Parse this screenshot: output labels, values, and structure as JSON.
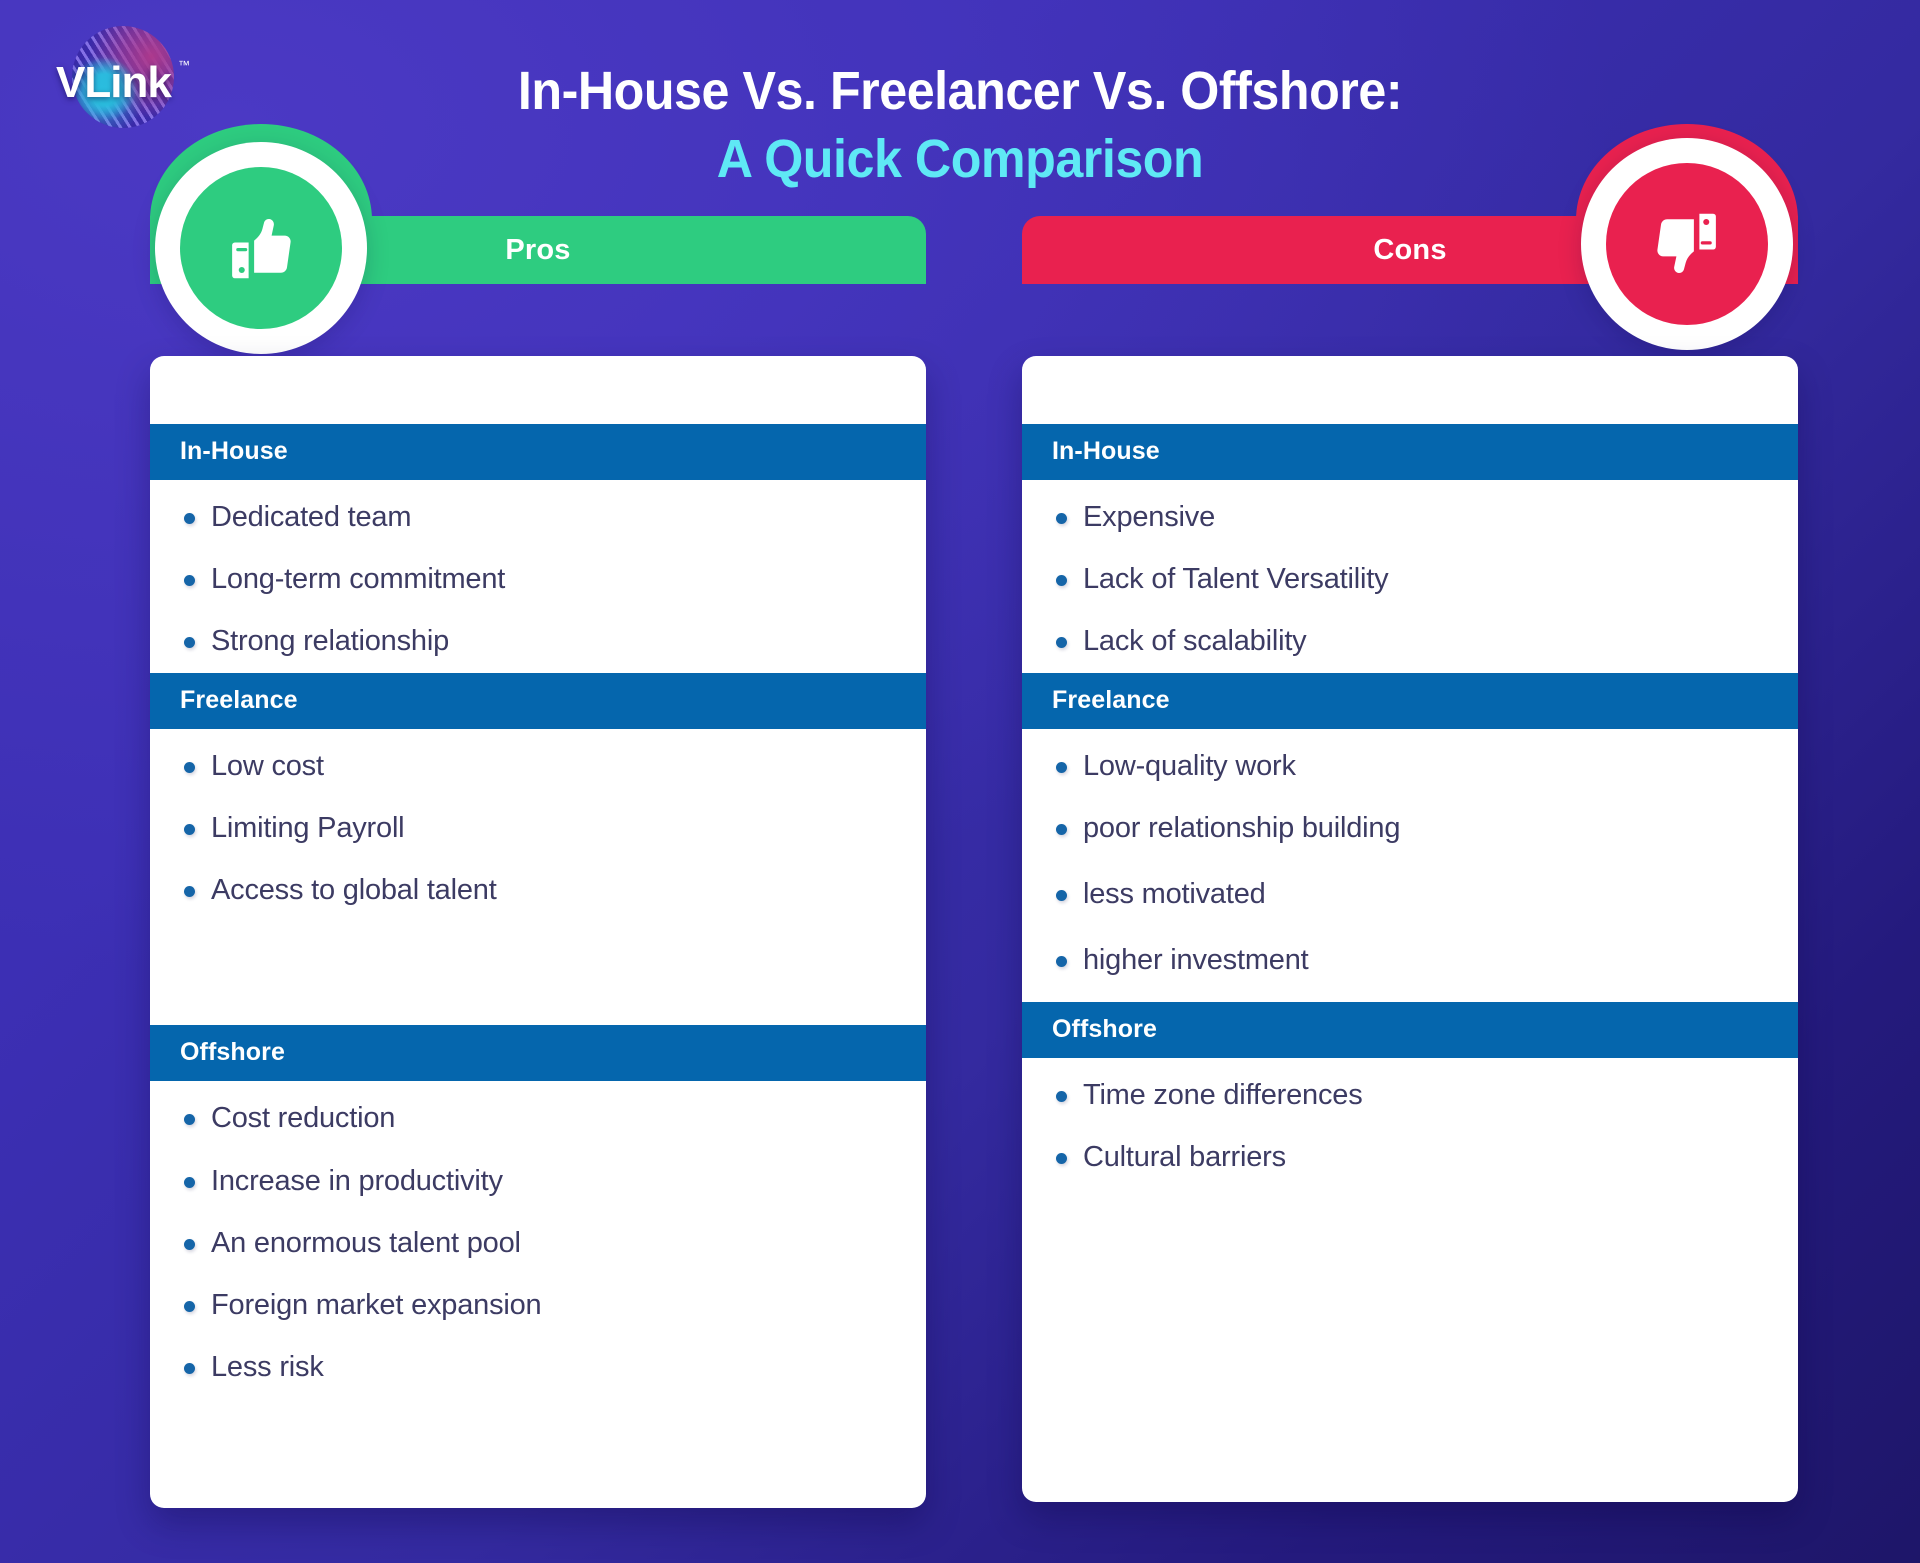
{
  "brand": {
    "name": "VLink",
    "trademark": "™",
    "logo_icon": "globe-icon"
  },
  "title": {
    "line1": "In-House Vs. Freelancer Vs. Offshore:",
    "line2": "A Quick Comparison"
  },
  "colors": {
    "pros_green": "#2ecc80",
    "cons_red": "#e9214f",
    "section_blue": "#0566ad",
    "bullet_blue": "#1565a8",
    "body_text": "#3c3b63",
    "title_accent": "#5fe9f5",
    "background_from": "#3b2fb0",
    "background_to": "#1e1669"
  },
  "columns": [
    {
      "key": "pros",
      "label": "Pros",
      "icon": "thumbs-up-icon",
      "sections": [
        {
          "heading": "In-House",
          "items": [
            "Dedicated team",
            "Long-term commitment",
            "Strong relationship"
          ]
        },
        {
          "heading": "Freelance",
          "items": [
            "Low cost",
            "Limiting Payroll",
            "Access to global talent"
          ]
        },
        {
          "heading": "Offshore",
          "items": [
            "Cost reduction",
            "Increase in productivity",
            "An enormous talent pool",
            "Foreign market expansion",
            "Less risk"
          ]
        }
      ]
    },
    {
      "key": "cons",
      "label": "Cons",
      "icon": "thumbs-down-icon",
      "sections": [
        {
          "heading": "In-House",
          "items": [
            "Expensive",
            "Lack of Talent Versatility",
            "Lack of scalability"
          ]
        },
        {
          "heading": "Freelance",
          "items": [
            "Low-quality work",
            "poor relationship building",
            "less motivated",
            "higher investment"
          ]
        },
        {
          "heading": "Offshore",
          "items": [
            "Time zone differences",
            "Cultural barriers"
          ]
        }
      ]
    }
  ]
}
